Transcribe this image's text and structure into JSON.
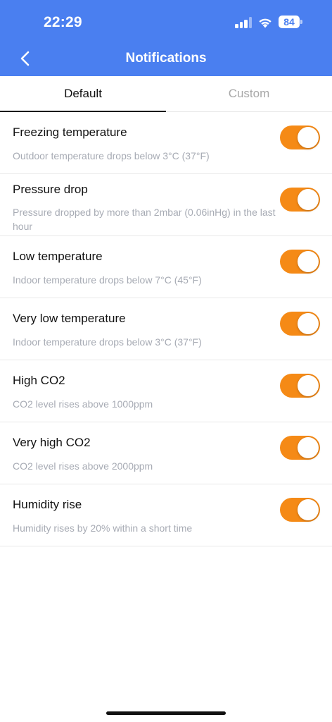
{
  "status_bar": {
    "time": "22:29",
    "battery_level": "84",
    "icons": [
      "signal-icon",
      "wifi-icon",
      "battery-icon"
    ]
  },
  "header": {
    "title": "Notifications",
    "back_icon": "chevron-left-icon"
  },
  "tabs": [
    {
      "label": "Default",
      "selected": true
    },
    {
      "label": "Custom",
      "selected": false
    }
  ],
  "notifications": [
    {
      "title": "Freezing temperature",
      "description": "Outdoor temperature drops below 3°C (37°F)",
      "enabled": true
    },
    {
      "title": "Pressure drop",
      "description": "Pressure dropped by more than 2mbar (0.06inHg) in the last hour",
      "enabled": true
    },
    {
      "title": "Low temperature",
      "description": "Indoor temperature drops below 7°C (45°F)",
      "enabled": true
    },
    {
      "title": "Very low temperature",
      "description": "Indoor temperature drops below 3°C (37°F)",
      "enabled": true
    },
    {
      "title": "High CO2",
      "description": "CO2 level rises above 1000ppm",
      "enabled": true
    },
    {
      "title": "Very high CO2",
      "description": "CO2 level rises above 2000ppm",
      "enabled": true
    },
    {
      "title": "Humidity rise",
      "description": "Humidity rises by 20% within a short time",
      "enabled": true
    }
  ],
  "colors": {
    "header_bg": "#4a7ff0",
    "toggle_on": "#f58a16",
    "description_text": "#a7abb4",
    "tab_inactive": "#a8a8a8"
  }
}
